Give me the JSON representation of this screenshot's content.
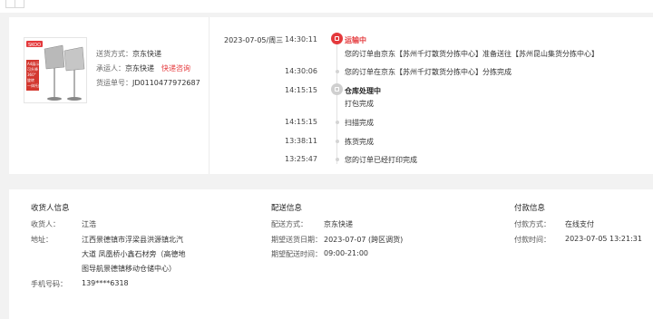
{
  "order_info": {
    "ship_label": "送货方式：",
    "ship_value": "京东快递",
    "carrier_label": "承运人：",
    "carrier_value": "京东快递",
    "carrier_link": "快递咨询",
    "waybill_label": "货运单号：",
    "waybill_value": "JD0110477972687"
  },
  "product_image": {
    "icon": "product-stand-image",
    "badge": "SKOO",
    "side_texts": [
      "A4展示",
      "可升降",
      "360°",
      "旋转",
      "一体托盘"
    ]
  },
  "timeline": {
    "date": "2023-07-05/周三",
    "events": [
      {
        "time": "14:30:11",
        "title": "运输中",
        "text": "您的订单由京东【苏州千灯散货分拣中心】准备送往【苏州昆山集货分拣中心】",
        "icon": "truck-icon"
      },
      {
        "time": "14:30:06",
        "title": "",
        "text": "您的订单在京东【苏州千灯散货分拣中心】分拣完成",
        "icon": ""
      },
      {
        "time": "14:15:15",
        "title": "仓库处理中",
        "text": "打包完成",
        "icon": "warehouse-icon"
      },
      {
        "time": "14:15:15",
        "title": "",
        "text": "扫描完成",
        "icon": ""
      },
      {
        "time": "13:38:11",
        "title": "",
        "text": "拣货完成",
        "icon": ""
      },
      {
        "time": "13:25:47",
        "title": "",
        "text": "您的订单已经打印完成",
        "icon": ""
      }
    ]
  },
  "receiver": {
    "title": "收货人信息",
    "name_label": "收货人：",
    "name_value": "江浩",
    "addr_label": "地址：",
    "addr_lines": [
      "江西景德镇市浮梁县洪源镇北汽",
      "大道 凤凰桥小鑫石材旁（高德地",
      "图导航景德镇移动仓储中心）"
    ],
    "phone_label": "手机号码：",
    "phone_value": "139****6318"
  },
  "delivery": {
    "title": "配送信息",
    "method_label": "配送方式：",
    "method_value": "京东快递",
    "date_label": "期望送货日期：",
    "date_value": "2023-07-07 (跨区调货)",
    "time_label": "期望配送时间：",
    "time_value": "09:00-21:00"
  },
  "payment": {
    "title": "付款信息",
    "method_label": "付款方式：",
    "method_value": "在线支付",
    "time_label": "付款时间：",
    "time_value": "2023-07-05 13:21:31"
  },
  "colors": {
    "accent": "#e4393c",
    "bg": "#f2f2f2"
  }
}
